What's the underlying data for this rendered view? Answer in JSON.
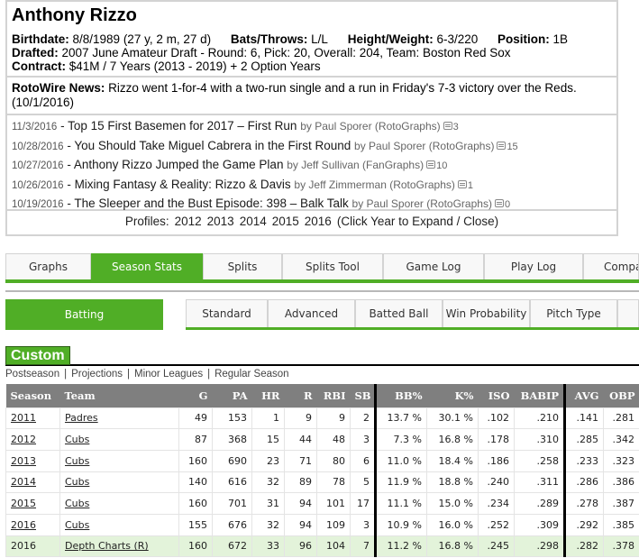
{
  "player": {
    "name": "Anthony Rizzo",
    "birthdate_label": "Birthdate:",
    "birthdate": "8/8/1989 (27 y, 2 m, 27 d)",
    "bats_throws_label": "Bats/Throws:",
    "bats_throws": "L/L",
    "height_weight_label": "Height/Weight:",
    "height_weight": "6-3/220",
    "position_label": "Position:",
    "position": "1B",
    "drafted_label": "Drafted:",
    "drafted": "2007 June Amateur Draft - Round: 6, Pick: 20, Overall: 204, Team: Boston Red Sox",
    "contract_label": "Contract:",
    "contract": "$41M / 7 Years (2013 - 2019) + 2 Option Years"
  },
  "news": {
    "label": "RotoWire News:",
    "text": "Rizzo went 1-for-4 with a two-run single and a run in Friday's 7-3 victory over the Reds. (10/1/2016)"
  },
  "articles": [
    {
      "date": "11/3/2016",
      "title": "Top 15 First Basemen for 2017 – First Run",
      "by": "by Paul Sporer (RotoGraphs)",
      "comments": "3"
    },
    {
      "date": "10/28/2016",
      "title": "You Should Take Miguel Cabrera in the First Round",
      "by": "by Paul Sporer (RotoGraphs)",
      "comments": "15"
    },
    {
      "date": "10/27/2016",
      "title": "Anthony Rizzo Jumped the Game Plan",
      "by": "by Jeff Sullivan (FanGraphs)",
      "comments": "10"
    },
    {
      "date": "10/26/2016",
      "title": "Mixing Fantasy & Reality: Rizzo & Davis",
      "by": "by Jeff Zimmerman (RotoGraphs)",
      "comments": "1"
    },
    {
      "date": "10/19/2016",
      "title": "The Sleeper and the Bust Episode: 398 – Balk Talk",
      "by": "by Paul Sporer (RotoGraphs)",
      "comments": "0"
    }
  ],
  "article_separator": " - ",
  "profiles": {
    "label": "Profiles:",
    "years": [
      "2012",
      "2013",
      "2014",
      "2015",
      "2016"
    ],
    "hint": "(Click Year to Expand / Close)"
  },
  "main_tabs": [
    {
      "label": "Graphs",
      "active": false
    },
    {
      "label": "Season Stats",
      "active": true
    },
    {
      "label": "Splits",
      "active": false
    },
    {
      "label": "Splits Tool",
      "active": false
    },
    {
      "label": "Game Log",
      "active": false
    },
    {
      "label": "Play Log",
      "active": false
    },
    {
      "label": "Compare",
      "active": false
    }
  ],
  "batting_button": "Batting",
  "sub_tabs": [
    "Standard",
    "Advanced",
    "Batted Ball",
    "Win Probability",
    "Pitch Type"
  ],
  "section_title": "Custom",
  "sublinks": [
    "Postseason",
    "Projections",
    "Minor Leagues",
    "Regular Season"
  ],
  "sublink_separator": "|",
  "table": {
    "headers": [
      "Season",
      "Team",
      "G",
      "PA",
      "HR",
      "R",
      "RBI",
      "SB",
      "BB%",
      "K%",
      "ISO",
      "BABIP",
      "AVG",
      "OBP"
    ],
    "rows": [
      {
        "cells": [
          "2011",
          "Padres",
          "49",
          "153",
          "1",
          "9",
          "9",
          "2",
          "13.7 %",
          "30.1 %",
          ".102",
          ".210",
          ".141",
          ".281"
        ],
        "projection": false
      },
      {
        "cells": [
          "2012",
          "Cubs",
          "87",
          "368",
          "15",
          "44",
          "48",
          "3",
          "7.3 %",
          "16.8 %",
          ".178",
          ".310",
          ".285",
          ".342"
        ],
        "projection": false
      },
      {
        "cells": [
          "2013",
          "Cubs",
          "160",
          "690",
          "23",
          "71",
          "80",
          "6",
          "11.0 %",
          "18.4 %",
          ".186",
          ".258",
          ".233",
          ".323"
        ],
        "projection": false
      },
      {
        "cells": [
          "2014",
          "Cubs",
          "140",
          "616",
          "32",
          "89",
          "78",
          "5",
          "11.9 %",
          "18.8 %",
          ".240",
          ".311",
          ".286",
          ".386"
        ],
        "projection": false
      },
      {
        "cells": [
          "2015",
          "Cubs",
          "160",
          "701",
          "31",
          "94",
          "101",
          "17",
          "11.1 %",
          "15.0 %",
          ".234",
          ".289",
          ".278",
          ".387"
        ],
        "projection": false
      },
      {
        "cells": [
          "2016",
          "Cubs",
          "155",
          "676",
          "32",
          "94",
          "109",
          "3",
          "10.9 %",
          "16.0 %",
          ".252",
          ".309",
          ".292",
          ".385"
        ],
        "projection": false
      },
      {
        "cells": [
          "2016",
          "Depth Charts (R)",
          "160",
          "672",
          "33",
          "96",
          "104",
          "7",
          "11.2 %",
          "16.8 %",
          ".245",
          ".298",
          ".282",
          ".378"
        ],
        "projection": true
      }
    ]
  },
  "colors": {
    "accent_green": "#50ae26",
    "header_gray": "#7f7f7f",
    "projection_row": "#e3f3da"
  }
}
